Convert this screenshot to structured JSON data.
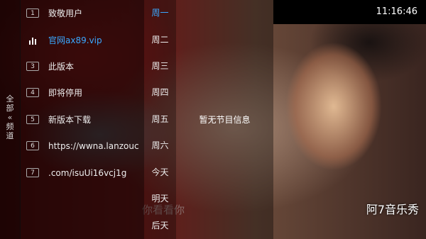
{
  "clock": "11:16:46",
  "left_tab": {
    "line1": "全",
    "line2": "部",
    "chevron": "«",
    "line3": "频",
    "line4": "道"
  },
  "channels": [
    {
      "num": "1",
      "name": "致敬用户",
      "active": false
    },
    {
      "num": "",
      "icon": "equalizer-icon",
      "name": "官网ax89.vip",
      "active": true
    },
    {
      "num": "3",
      "name": "此版本",
      "active": false
    },
    {
      "num": "4",
      "name": "即将停用",
      "active": false
    },
    {
      "num": "5",
      "name": "新版本下载",
      "active": false
    },
    {
      "num": "6",
      "name": "https://wwna.lanzouc",
      "active": false
    },
    {
      "num": "7",
      "name": ".com/isuUi16vcj1g",
      "active": false
    }
  ],
  "days": [
    "周一",
    "周二",
    "周三",
    "周四",
    "周五",
    "周六",
    "今天",
    "明天",
    "后天"
  ],
  "active_day_index": 0,
  "program_info": "暂无节目信息",
  "video_subtitle": "你看看你",
  "watermark": "阿7音乐秀",
  "colors": {
    "accent": "#3aa8ff"
  }
}
